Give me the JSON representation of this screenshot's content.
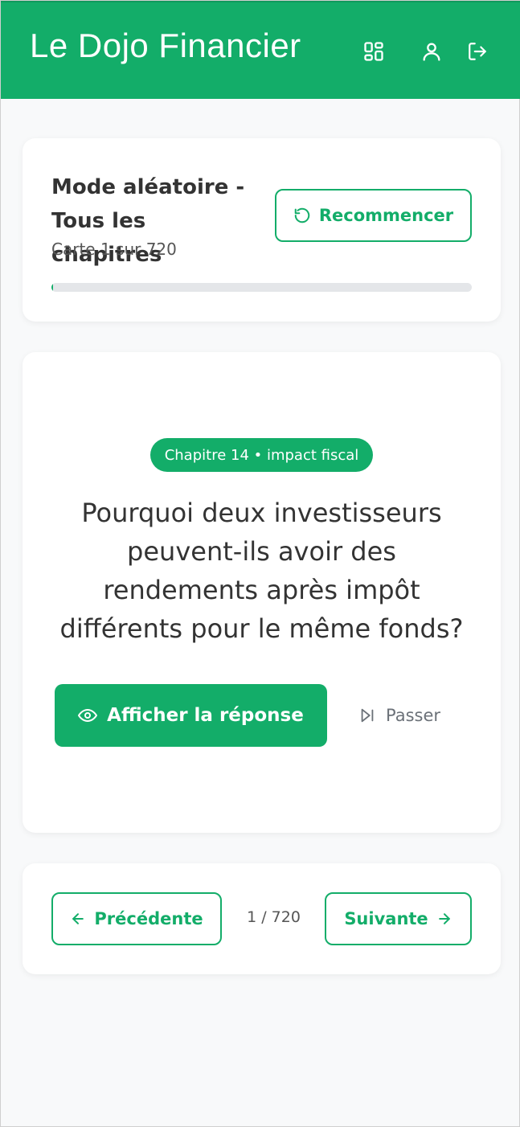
{
  "header": {
    "brand": "Le Dojo Financier",
    "icons": [
      "dashboard-icon",
      "user-icon",
      "logout-icon"
    ],
    "background": "#13ad69"
  },
  "session": {
    "title": "Mode aléatoire - Tous les chapitres",
    "subtitle": "Carte 1 sur 720",
    "restart_label": "Recommencer",
    "progress_percent": 0.14
  },
  "card": {
    "badge": "Chapitre 14 • impact fiscal",
    "question": "Pourquoi deux investisseurs peuvent-ils avoir des rendements après impôt différents pour le même fonds?",
    "reveal_label": "Afficher la réponse",
    "skip_label": "Passer"
  },
  "navigation": {
    "prev_label": "Précédente",
    "counter": "1 / 720",
    "next_label": "Suivante"
  },
  "colors": {
    "accent": "#13ad69",
    "background": "#f8f9fa",
    "muted_text": "#6b7178"
  }
}
